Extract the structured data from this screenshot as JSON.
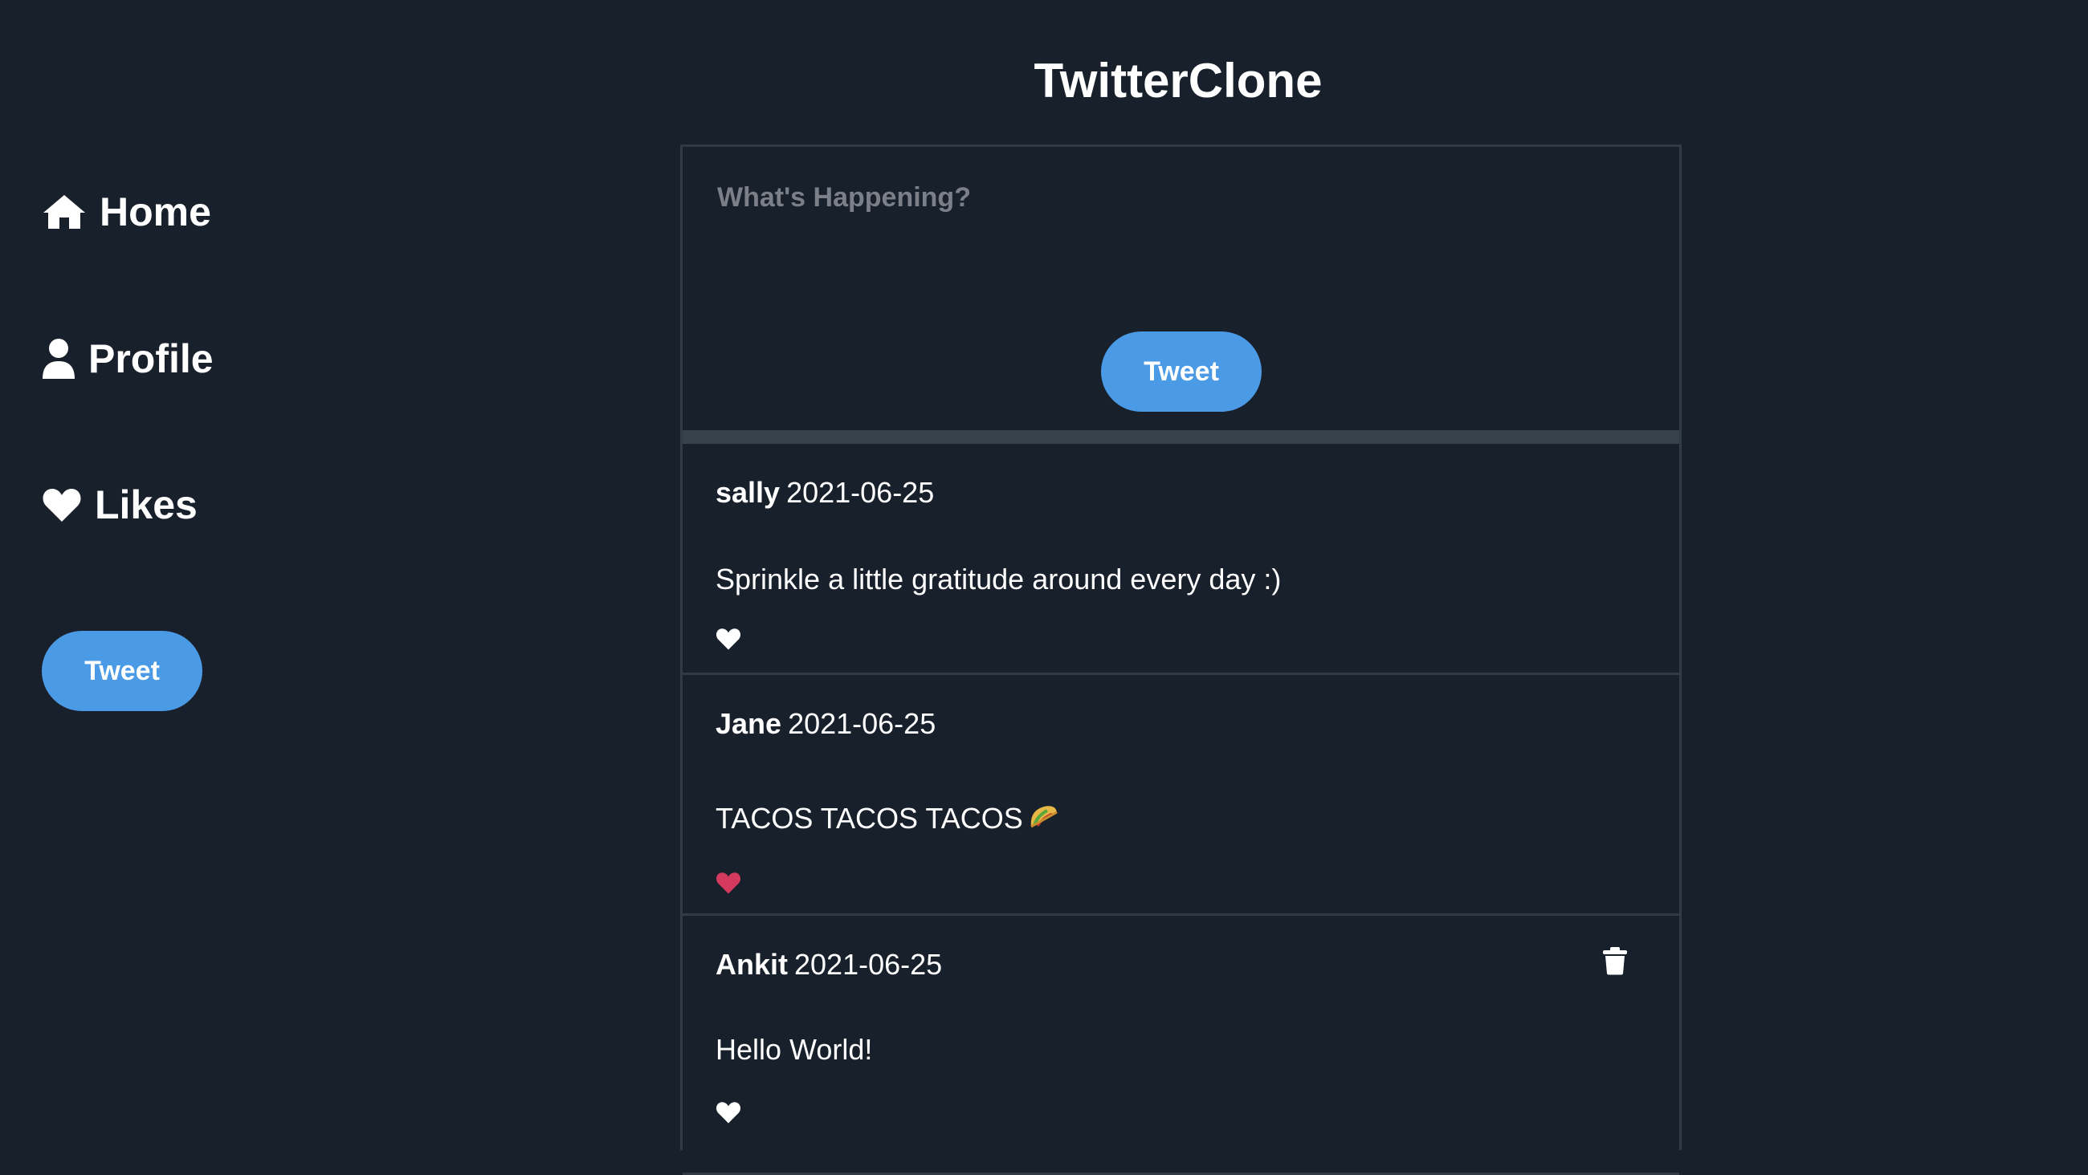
{
  "app": {
    "title": "TwitterClone"
  },
  "sidebar": {
    "items": [
      {
        "label": "Home",
        "icon": "home-icon"
      },
      {
        "label": "Profile",
        "icon": "user-icon"
      },
      {
        "label": "Likes",
        "icon": "heart-icon"
      }
    ],
    "tweet_button_label": "Tweet"
  },
  "composer": {
    "placeholder": "What's Happening?",
    "value": "",
    "tweet_button_label": "Tweet"
  },
  "tweets": [
    {
      "author": "sally",
      "date": "2021-06-25",
      "text": "Sprinkle a little gratitude around every day :)",
      "liked": false,
      "deletable": false
    },
    {
      "author": "Jane",
      "date": "2021-06-25",
      "text": "TACOS TACOS TACOS",
      "emoji": "taco-icon",
      "liked": true,
      "deletable": false
    },
    {
      "author": "Ankit",
      "date": "2021-06-25",
      "text": "Hello World!",
      "liked": false,
      "deletable": true
    }
  ],
  "colors": {
    "background": "#18202b",
    "accent": "#4a9ae6",
    "liked": "#d33a5d",
    "border": "#313b46",
    "placeholder": "#7b8088"
  }
}
